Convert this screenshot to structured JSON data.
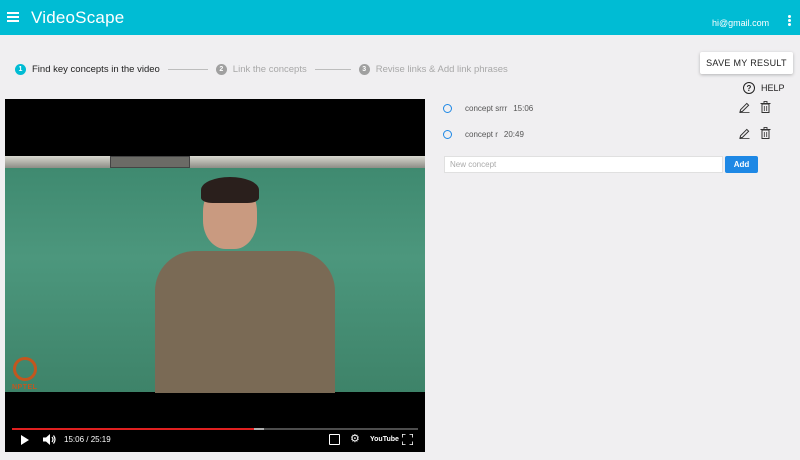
{
  "appbar": {
    "title": "VideoScape",
    "user_email": "hi@gmail.com",
    "menu_icon": "menu-icon",
    "more_icon": "more-vert-icon"
  },
  "stepper": {
    "steps": [
      {
        "number": "1",
        "label": "Find key concepts in the video",
        "state": "active"
      },
      {
        "number": "2",
        "label": "Link the concepts",
        "state": "inactive"
      },
      {
        "number": "3",
        "label": "Revise links & Add link phrases",
        "state": "inactive"
      }
    ]
  },
  "actions": {
    "save_label": "SAVE MY RESULT",
    "help_label": "HELP",
    "help_symbol": "?"
  },
  "video": {
    "time_display": "15:06 / 25:19",
    "played_fraction": 0.597,
    "buffered_fraction": 0.62,
    "logo_text": "NPTEL",
    "youtube_label": "YouTube"
  },
  "concepts": [
    {
      "name": "concept srrr",
      "time": "15:06"
    },
    {
      "name": "concept r",
      "time": "20:49"
    }
  ],
  "new_concept": {
    "placeholder": "New concept",
    "value": "",
    "add_label": "Add"
  },
  "colors": {
    "accent": "#00bcd4",
    "primary_button": "#1e88e5",
    "progress": "#e02020"
  }
}
